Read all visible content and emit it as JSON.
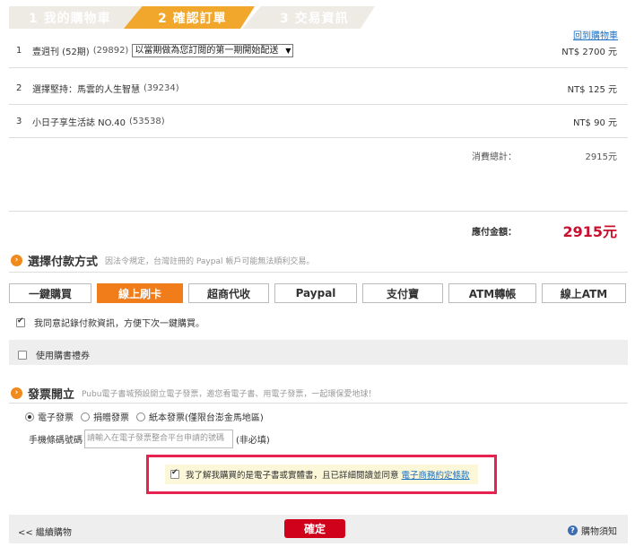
{
  "steps": [
    {
      "label": "1 我的購物車"
    },
    {
      "label": "2 確認訂單"
    },
    {
      "label": "3 交易資訊"
    }
  ],
  "back_to_cart": "回到購物車",
  "items": [
    {
      "num": "1",
      "name": "壹週刊 (52期)",
      "code": "(29892)",
      "delivery_select": "以當期做為您訂閱的第一期開始配送",
      "price": "NT$ 2700 元"
    },
    {
      "num": "2",
      "name": "選擇堅持：馬雲的人生智慧",
      "code": "(39234)",
      "price": "NT$ 125 元"
    },
    {
      "num": "3",
      "name": "小日子享生活誌 NO.40",
      "code": "(53538)",
      "price": "NT$ 90 元"
    }
  ],
  "subtotal": {
    "label": "消費總計：",
    "value": "2915元"
  },
  "payable": {
    "label": "應付金額：",
    "value": "2915元"
  },
  "payment": {
    "title": "選擇付款方式",
    "note": "因法令規定，台灣註冊的 Paypal 帳戶可能無法順利交易。",
    "tabs": [
      "一鍵購買",
      "線上刷卡",
      "超商代收",
      "Paypal",
      "支付寶",
      "ATM轉帳",
      "線上ATM"
    ],
    "active_tab": "線上刷卡",
    "remember_label": "我同意記錄付款資訊，方便下次一鍵購買。",
    "coupon_label": "使用購書禮券"
  },
  "invoice": {
    "title": "發票開立",
    "note": "Pubu電子書城預設開立電子發票，邀您看電子書、用電子發票，一起環保愛地球！",
    "options": [
      "電子發票",
      "捐贈發票",
      "紙本發票(僅限台澎金馬地區)"
    ],
    "selected": "電子發票",
    "barcode_label": "手機條碼號碼",
    "barcode_placeholder": "請輸入在電子發票整合平台申請的號碼",
    "optional_note": "(非必填)"
  },
  "agreement": {
    "text": "我了解我購買的是電子書或實體書，且已詳細閱讀並同意",
    "link": "電子商務約定條款",
    "checked": true
  },
  "footer": {
    "continue": "<< 繼續購物",
    "confirm": "確定",
    "notice": "購物須知"
  },
  "colors": {
    "active_step": "#f1a72c",
    "active_tab": "#f07d1a",
    "price_red": "#c8102e",
    "confirm_button": "#d0021b",
    "highlight_border": "#e8224f",
    "link": "#1a6fc4"
  }
}
